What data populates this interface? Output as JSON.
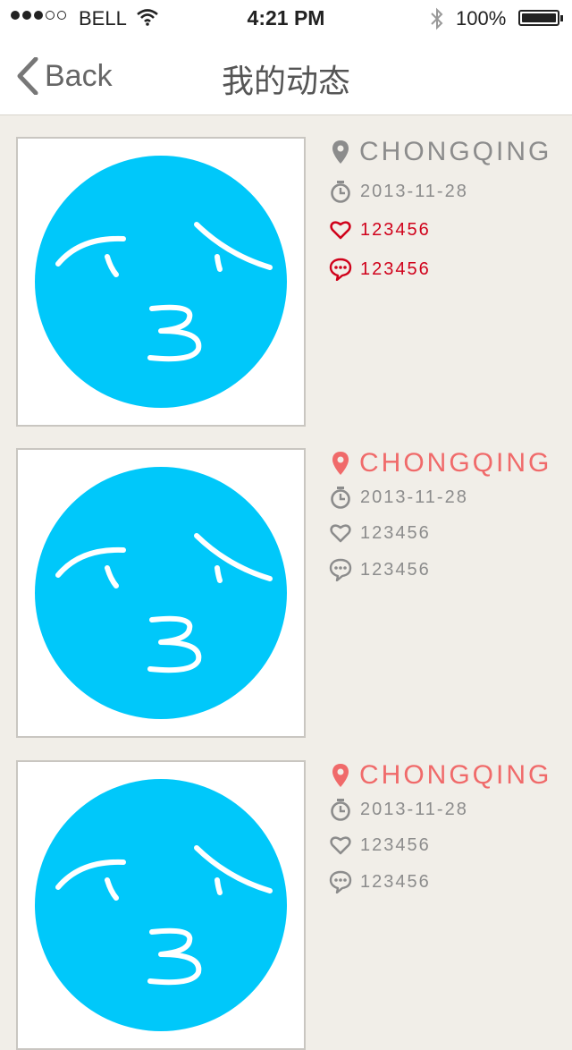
{
  "status_bar": {
    "carrier": "BELL",
    "time": "4:21 PM",
    "battery": "100%"
  },
  "nav": {
    "back_label": "Back",
    "title": "我的动态"
  },
  "colors": {
    "accent_red": "#d0021b",
    "location_red": "#f06a6a",
    "gray": "#8c8c8c",
    "avatar_blue": "#00c8fa",
    "background": "#f1eee8"
  },
  "posts": [
    {
      "location": "CHONGQING",
      "date": "2013-11-28",
      "likes": "123456",
      "comments": "123456",
      "highlight": "likes-comments",
      "location_active": false
    },
    {
      "location": "CHONGQING",
      "date": "2013-11-28",
      "likes": "123456",
      "comments": "123456",
      "highlight": "none",
      "location_active": true
    },
    {
      "location": "CHONGQING",
      "date": "2013-11-28",
      "likes": "123456",
      "comments": "123456",
      "highlight": "none",
      "location_active": true
    }
  ],
  "icons": {
    "location": "location-pin-icon",
    "date": "stopwatch-icon",
    "likes": "heart-icon",
    "comments": "comment-bubble-icon",
    "thumbnail": "blue-face-avatar"
  }
}
